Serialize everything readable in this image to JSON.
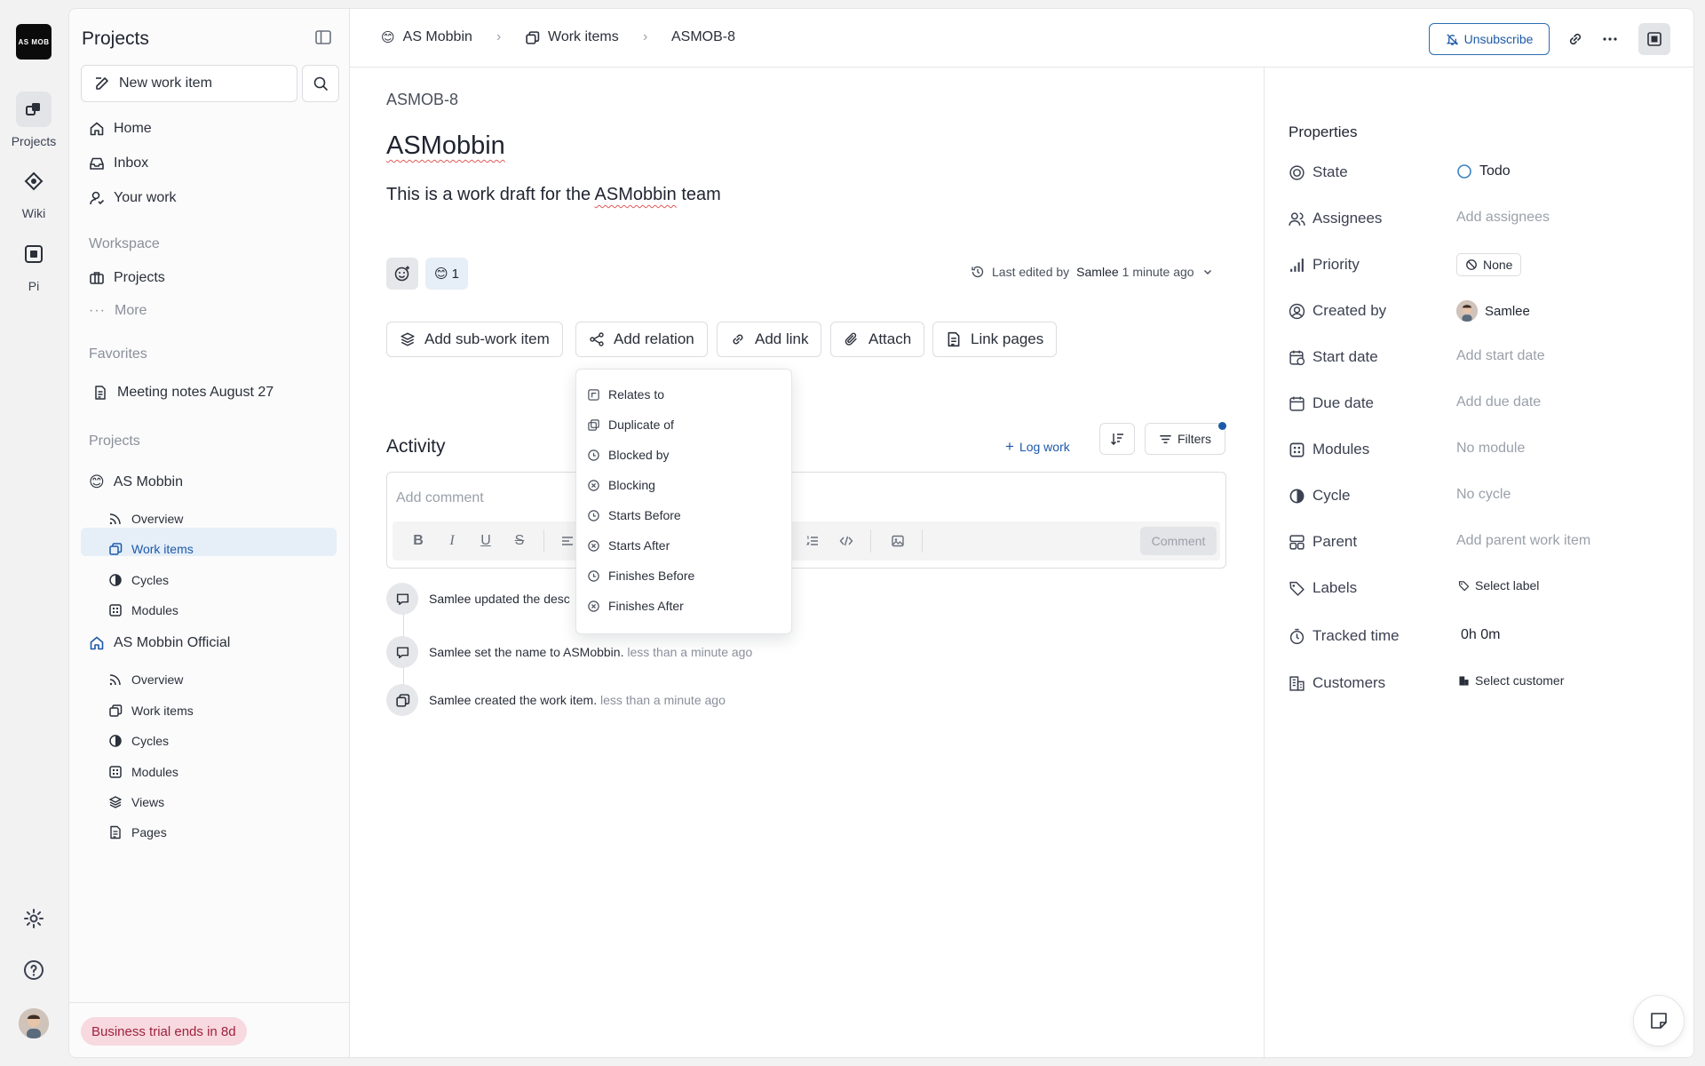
{
  "rail": {
    "logo_text": "AS MOB",
    "items": [
      {
        "label": "Projects",
        "icon": "projects-icon"
      },
      {
        "label": "Wiki",
        "icon": "wiki-icon"
      },
      {
        "label": "Pi",
        "icon": "pi-icon"
      }
    ]
  },
  "sidebar": {
    "title": "Projects",
    "new_item_label": "New work item",
    "nav": [
      {
        "label": "Home",
        "icon": "home-icon"
      },
      {
        "label": "Inbox",
        "icon": "inbox-icon"
      },
      {
        "label": "Your work",
        "icon": "user-icon"
      }
    ],
    "workspace_label": "Workspace",
    "workspace_items": [
      {
        "label": "Projects",
        "icon": "briefcase-icon"
      },
      {
        "label": "More",
        "icon": "more-icon"
      }
    ],
    "favorites_label": "Favorites",
    "favorites": [
      {
        "label": "Meeting notes August 27",
        "icon": "page-icon"
      }
    ],
    "projects_label": "Projects",
    "projects": [
      {
        "name": "AS Mobbin",
        "emoji": "😊",
        "subitems": [
          "Overview",
          "Work items",
          "Cycles",
          "Modules"
        ]
      },
      {
        "name": "AS Mobbin Official",
        "emoji": "",
        "subitems": [
          "Overview",
          "Work items",
          "Cycles",
          "Modules",
          "Views",
          "Pages"
        ]
      }
    ],
    "trial_badge": "Business trial ends in 8d"
  },
  "header": {
    "breadcrumb": [
      {
        "label": "AS Mobbin",
        "icon": "emoji-smile"
      },
      {
        "label": "Work items",
        "icon": "work-items-icon"
      },
      {
        "label": "ASMOB-8",
        "icon": ""
      }
    ],
    "unsubscribe_label": "Unsubscribe"
  },
  "issue": {
    "id": "ASMOB-8",
    "title": "ASMobbin",
    "description_before": "This is a work draft for the ",
    "description_highlight": "ASMobbin",
    "description_after": " team",
    "reaction_emoji": "😊",
    "reaction_count": "1",
    "last_edited_prefix": "Last edited by",
    "last_edited_user": "Samlee",
    "last_edited_when": "1 minute ago"
  },
  "actions": [
    {
      "label": "Add sub-work item",
      "icon": "layers-icon"
    },
    {
      "label": "Add relation",
      "icon": "relation-icon"
    },
    {
      "label": "Add link",
      "icon": "link-icon"
    },
    {
      "label": "Attach",
      "icon": "paperclip-icon"
    },
    {
      "label": "Link pages",
      "icon": "page-icon"
    }
  ],
  "relation_menu": [
    {
      "label": "Relates to",
      "icon": "relates-icon"
    },
    {
      "label": "Duplicate of",
      "icon": "duplicate-icon"
    },
    {
      "label": "Blocked by",
      "icon": "blocked-icon"
    },
    {
      "label": "Blocking",
      "icon": "blocking-icon"
    },
    {
      "label": "Starts Before",
      "icon": "clock-icon"
    },
    {
      "label": "Starts After",
      "icon": "x-circle-icon"
    },
    {
      "label": "Finishes Before",
      "icon": "clock-icon"
    },
    {
      "label": "Finishes After",
      "icon": "x-circle-icon"
    }
  ],
  "activity": {
    "title": "Activity",
    "log_work_label": "Log work",
    "filters_label": "Filters",
    "comment_placeholder": "Add comment",
    "comment_button": "Comment",
    "entries": [
      {
        "user": "Samlee",
        "text": "updated the desc",
        "when": ""
      },
      {
        "user": "Samlee",
        "text": "set the name to ASMobbin.",
        "when": "less than a minute ago"
      },
      {
        "user": "Samlee",
        "text": "created the work item.",
        "when": "less than a minute ago"
      }
    ]
  },
  "properties": {
    "title": "Properties",
    "rows": [
      {
        "label": "State",
        "value": "Todo",
        "style": "state"
      },
      {
        "label": "Assignees",
        "value": "Add assignees",
        "style": "placeholder"
      },
      {
        "label": "Priority",
        "value": "None",
        "style": "chip"
      },
      {
        "label": "Created by",
        "value": "Samlee",
        "style": "user"
      },
      {
        "label": "Start date",
        "value": "Add start date",
        "style": "placeholder"
      },
      {
        "label": "Due date",
        "value": "Add due date",
        "style": "placeholder"
      },
      {
        "label": "Modules",
        "value": "No module",
        "style": "placeholder"
      },
      {
        "label": "Cycle",
        "value": "No cycle",
        "style": "placeholder"
      },
      {
        "label": "Parent",
        "value": "Add parent work item",
        "style": "placeholder"
      },
      {
        "label": "Labels",
        "value": "Select label",
        "style": "label-chip"
      },
      {
        "label": "Tracked time",
        "value": "0h 0m",
        "style": "dark"
      },
      {
        "label": "Customers",
        "value": "Select customer",
        "style": "customer-chip"
      }
    ]
  },
  "colors": {
    "accent": "#1d5aa8",
    "trial_bg": "#f7d9df",
    "trial_text": "#a0223f",
    "active_nav": "#e6eef7"
  }
}
